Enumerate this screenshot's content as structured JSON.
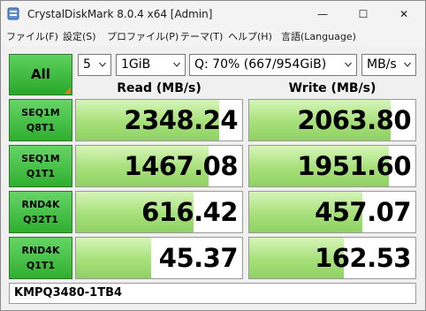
{
  "window": {
    "title": "CrystalDiskMark 8.0.4 x64 [Admin]",
    "minimize_glyph": "—",
    "maximize_glyph": "☐",
    "close_glyph": "✕"
  },
  "menu": [
    {
      "label": "ファイル(F)"
    },
    {
      "label": "設定(S)"
    },
    {
      "label": "プロファイル(P)"
    },
    {
      "label": "テーマ(T)"
    },
    {
      "label": "ヘルプ(H)"
    },
    {
      "label": "言語(Language)"
    }
  ],
  "controls": {
    "all_label": "All",
    "count": "5",
    "size": "1GiB",
    "drive": "Q: 70% (667/954GiB)",
    "unit": "MB/s"
  },
  "headers": {
    "read": "Read (MB/s)",
    "write": "Write (MB/s)"
  },
  "tests": [
    {
      "line1": "SEQ1M",
      "line2": "Q8T1",
      "read": "2348.24",
      "write": "2063.80",
      "read_fill": 0.86,
      "write_fill": 0.85
    },
    {
      "line1": "SEQ1M",
      "line2": "Q1T1",
      "read": "1467.08",
      "write": "1951.60",
      "read_fill": 0.8,
      "write_fill": 0.84
    },
    {
      "line1": "RND4K",
      "line2": "Q32T1",
      "read": "616.42",
      "write": "457.07",
      "read_fill": 0.71,
      "write_fill": 0.68
    },
    {
      "line1": "RND4K",
      "line2": "Q1T1",
      "read": "45.37",
      "write": "162.53",
      "read_fill": 0.45,
      "write_fill": 0.57
    }
  ],
  "comment": "KMPQ3480-1TB4",
  "colors": {
    "accent_green": "#2fae2f",
    "bar_green": "#a7e07a",
    "corner_orange": "#e87a1a"
  },
  "icons": {
    "app": "crystaldiskmark-icon",
    "dropdown": "chevron-down-icon"
  }
}
